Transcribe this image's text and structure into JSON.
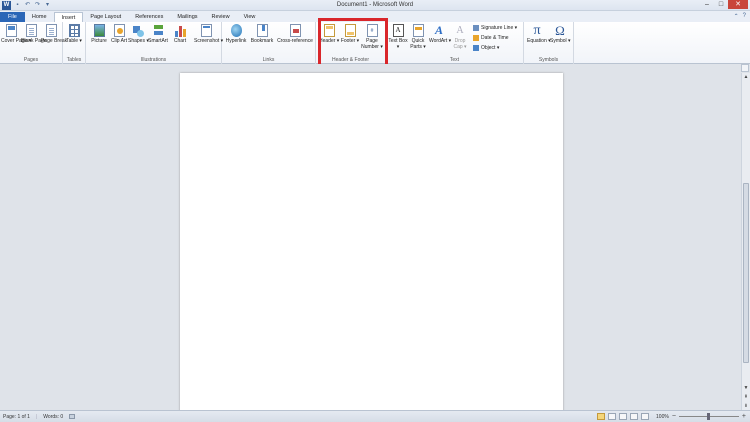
{
  "app": {
    "title": "Document1 - Microsoft Word",
    "icon_letter": "W",
    "window_controls": [
      "–",
      "□",
      "✕"
    ]
  },
  "quick_access": [
    "save-icon",
    "undo-icon",
    "redo-icon",
    "customize-icon"
  ],
  "tabs": [
    {
      "label": "File"
    },
    {
      "label": "Home"
    },
    {
      "label": "Insert"
    },
    {
      "label": "Page Layout"
    },
    {
      "label": "References"
    },
    {
      "label": "Mailings"
    },
    {
      "label": "Review"
    },
    {
      "label": "View"
    }
  ],
  "active_tab": "Insert",
  "ribbon": {
    "pages": {
      "label": "Pages",
      "cover_page": "Cover Page ▾",
      "blank_page": "Blank Page",
      "page_break": "Page Break"
    },
    "tables": {
      "label": "Tables",
      "table": "Table ▾"
    },
    "illustrations": {
      "label": "Illustrations",
      "picture": "Picture",
      "clip_art": "Clip Art",
      "shapes": "Shapes ▾",
      "smartart": "SmartArt",
      "chart": "Chart",
      "screenshot": "Screenshot ▾"
    },
    "links": {
      "label": "Links",
      "hyperlink": "Hyperlink",
      "bookmark": "Bookmark",
      "cross_reference": "Cross-reference"
    },
    "header_footer": {
      "label": "Header & Footer",
      "header": "Header ▾",
      "footer": "Footer ▾",
      "page_number": "Page Number ▾",
      "page_number_glyph": "#"
    },
    "text": {
      "label": "Text",
      "text_box": "Text Box ▾",
      "quick_parts": "Quick Parts ▾",
      "wordart": "WordArt ▾",
      "drop_cap": "Drop Cap ▾",
      "signature_line": "Signature Line ▾",
      "date_time": "Date & Time",
      "object": "Object ▾",
      "text_box_glyph": "A",
      "wordart_glyph": "A",
      "drop_cap_glyph": "A"
    },
    "symbols": {
      "label": "Symbols",
      "equation": "Equation ▾",
      "symbol": "Symbol ▾",
      "equation_glyph": "π",
      "symbol_glyph": "Ω"
    }
  },
  "status": {
    "page": "Page: 1 of 1",
    "words": "Words: 0",
    "zoom": "100%",
    "zoom_minus": "−",
    "zoom_plus": "+"
  },
  "colors": {
    "file_tab": "#2a66b7",
    "highlight": "#d9262b"
  }
}
